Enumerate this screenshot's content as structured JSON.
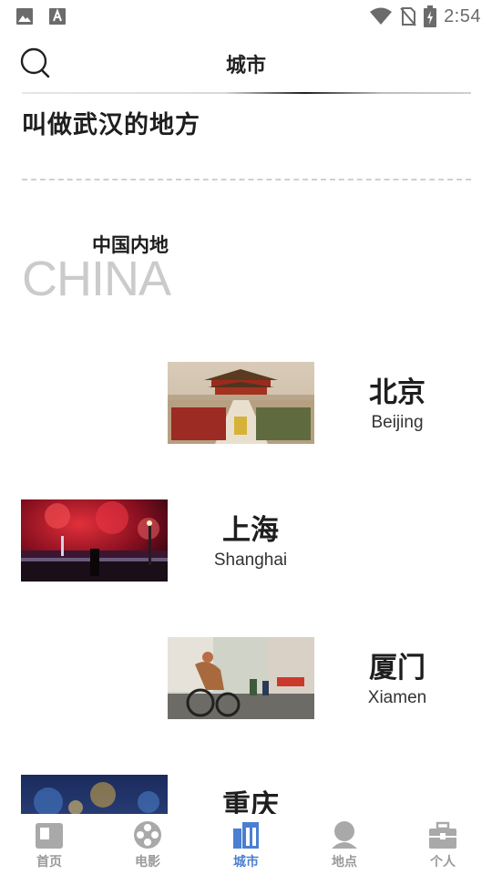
{
  "status_bar": {
    "time": "2:54",
    "left_icons": [
      "image-icon",
      "font-download-icon"
    ],
    "right_icons": [
      "wifi-icon",
      "no-sim-icon",
      "battery-charging-icon"
    ]
  },
  "header": {
    "title": "城市",
    "search_icon": "search-icon"
  },
  "headline": "叫做武汉的地方",
  "region": {
    "title": "中国内地",
    "english": "CHINA"
  },
  "cities": [
    {
      "name_cn": "北京",
      "name_en": "Beijing",
      "photo": "forbidden-city-photo"
    },
    {
      "name_cn": "上海",
      "name_en": "Shanghai",
      "photo": "bund-fireworks-photo"
    },
    {
      "name_cn": "厦门",
      "name_en": "Xiamen",
      "photo": "cycling-race-photo"
    },
    {
      "name_cn": "重庆",
      "name_en": "",
      "photo": "night-city-photo"
    }
  ],
  "bottom_nav": {
    "items": [
      {
        "label": "首页",
        "icon": "home-icon",
        "active": false
      },
      {
        "label": "电影",
        "icon": "film-reel-icon",
        "active": false
      },
      {
        "label": "城市",
        "icon": "city-building-icon",
        "active": true
      },
      {
        "label": "地点",
        "icon": "person-place-icon",
        "active": false
      },
      {
        "label": "个人",
        "icon": "briefcase-icon",
        "active": false
      }
    ]
  },
  "colors": {
    "accent": "#4a7fd1",
    "inactive": "#9a9a9a",
    "text": "#1e1e1e",
    "faint_text": "#cbcbcb"
  }
}
